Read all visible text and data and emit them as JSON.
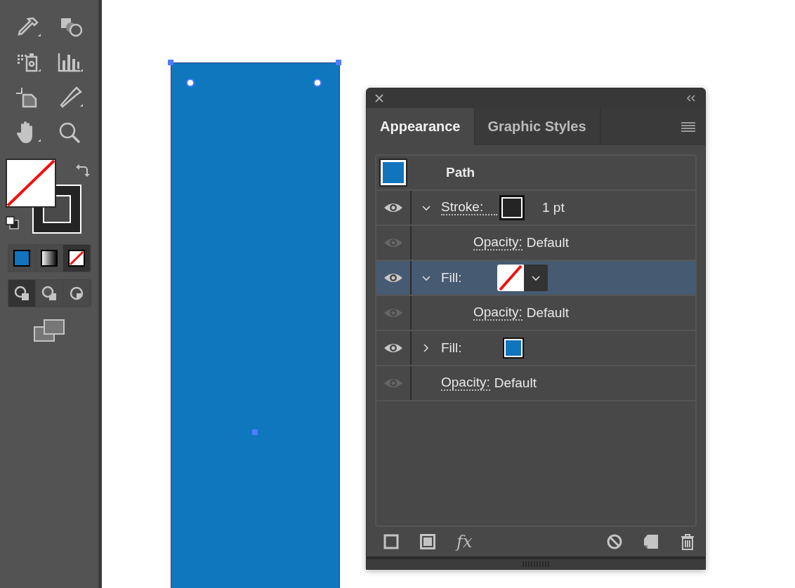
{
  "toolbar": {
    "color_modes": [
      {
        "kind": "color",
        "selected": false
      },
      {
        "kind": "gradient",
        "selected": false
      },
      {
        "kind": "none",
        "selected": true
      }
    ],
    "draw_modes": [
      {
        "kind": "normal",
        "selected": true
      },
      {
        "kind": "behind",
        "selected": false
      },
      {
        "kind": "inside",
        "selected": false
      }
    ]
  },
  "panel": {
    "tabs": [
      {
        "label": "Appearance",
        "selected": true
      },
      {
        "label": "Graphic Styles",
        "selected": false
      }
    ],
    "object": {
      "title": "Path",
      "color": "#1075bd"
    },
    "rows": [
      {
        "kind": "stroke",
        "label": "Stroke:",
        "swatch": {
          "kind": "stroke"
        },
        "value": "1 pt",
        "visible": true,
        "expanded": true,
        "selected": false,
        "children": [
          {
            "kind": "opacity",
            "label": "Opacity:",
            "value": "Default",
            "visible": false,
            "selected": false
          }
        ]
      },
      {
        "kind": "fill",
        "label": "Fill:",
        "swatch": {
          "kind": "none"
        },
        "visible": true,
        "expanded": true,
        "selected": true,
        "children": [
          {
            "kind": "opacity",
            "label": "Opacity:",
            "value": "Default",
            "visible": false,
            "selected": false
          }
        ]
      },
      {
        "kind": "fill",
        "label": "Fill:",
        "swatch": {
          "kind": "color",
          "color": "#1075bd"
        },
        "visible": true,
        "expanded": false,
        "selected": false
      },
      {
        "kind": "opacity",
        "label": "Opacity:",
        "value": "Default",
        "visible": false,
        "selected": false
      }
    ],
    "fx_button": "fx"
  }
}
